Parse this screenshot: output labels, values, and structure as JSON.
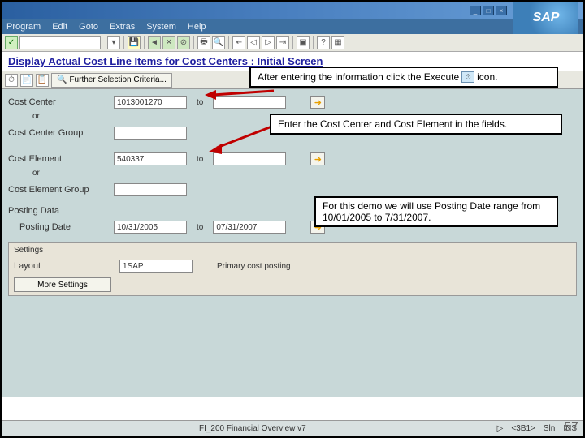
{
  "window": {
    "sap_logo": "SAP"
  },
  "menu": {
    "items": [
      "Program",
      "Edit",
      "Goto",
      "Extras",
      "System",
      "Help"
    ]
  },
  "page": {
    "title": "Display Actual Cost Line Items for Cost Centers : Initial Screen"
  },
  "subtoolbar": {
    "further": "Further Selection Criteria..."
  },
  "fields": {
    "cost_center_label": "Cost Center",
    "cost_center_val": "1013001270",
    "cost_center_to": "",
    "or1": "or",
    "cost_center_group_label": "Cost Center Group",
    "cost_center_group_val": "",
    "cost_element_label": "Cost Element",
    "cost_element_val": "540337",
    "cost_element_to": "",
    "or2": "or",
    "cost_element_group_label": "Cost Element Group",
    "cost_element_group_val": "",
    "posting_data_hdr": "Posting Data",
    "posting_date_label": "Posting Date",
    "posting_date_from": "10/31/2005",
    "posting_date_to_label": "to",
    "posting_date_to": "07/31/2007"
  },
  "settings": {
    "title": "Settings",
    "layout_label": "Layout",
    "layout_val": "1SAP",
    "layout_desc": "Primary cost posting",
    "more_btn": "More Settings"
  },
  "callouts": {
    "c1a": "After entering the information click the Execute",
    "c1b": "icon.",
    "c2": "Enter the Cost Center and Cost Element in the fields.",
    "c3": "For this demo we will use Posting Date range from 10/01/2005 to 7/31/2007."
  },
  "footer": {
    "center": "FI_200 Financial Overview v7",
    "status1": "<3B1>",
    "status2": "Sln",
    "status3": "INS"
  },
  "page_number": "57",
  "to_label": "to"
}
